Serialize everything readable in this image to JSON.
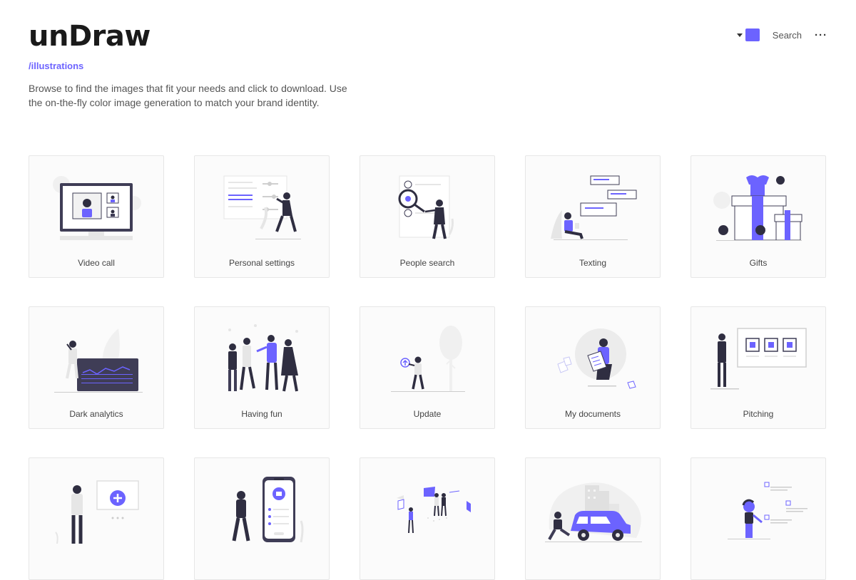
{
  "header": {
    "logo": "unDraw",
    "route": "/illustrations",
    "intro": "Browse to find the images that fit your needs and click to download. Use the on-the-fly color image generation to match your brand identity.",
    "search_label": "Search",
    "more_label": "···",
    "accent_color": "#6c63ff"
  },
  "illustrations": [
    {
      "label": "Video call",
      "icon": "video-call-illustration"
    },
    {
      "label": "Personal settings",
      "icon": "personal-settings-illustration"
    },
    {
      "label": "People search",
      "icon": "people-search-illustration"
    },
    {
      "label": "Texting",
      "icon": "texting-illustration"
    },
    {
      "label": "Gifts",
      "icon": "gifts-illustration"
    },
    {
      "label": "Dark analytics",
      "icon": "dark-analytics-illustration"
    },
    {
      "label": "Having fun",
      "icon": "having-fun-illustration"
    },
    {
      "label": "Update",
      "icon": "update-illustration"
    },
    {
      "label": "My documents",
      "icon": "my-documents-illustration"
    },
    {
      "label": "Pitching",
      "icon": "pitching-illustration"
    },
    {
      "label": "",
      "icon": "add-content-illustration"
    },
    {
      "label": "",
      "icon": "mobile-inbox-illustration"
    },
    {
      "label": "",
      "icon": "floating-cards-illustration"
    },
    {
      "label": "",
      "icon": "car-city-illustration"
    },
    {
      "label": "",
      "icon": "person-list-illustration"
    }
  ]
}
